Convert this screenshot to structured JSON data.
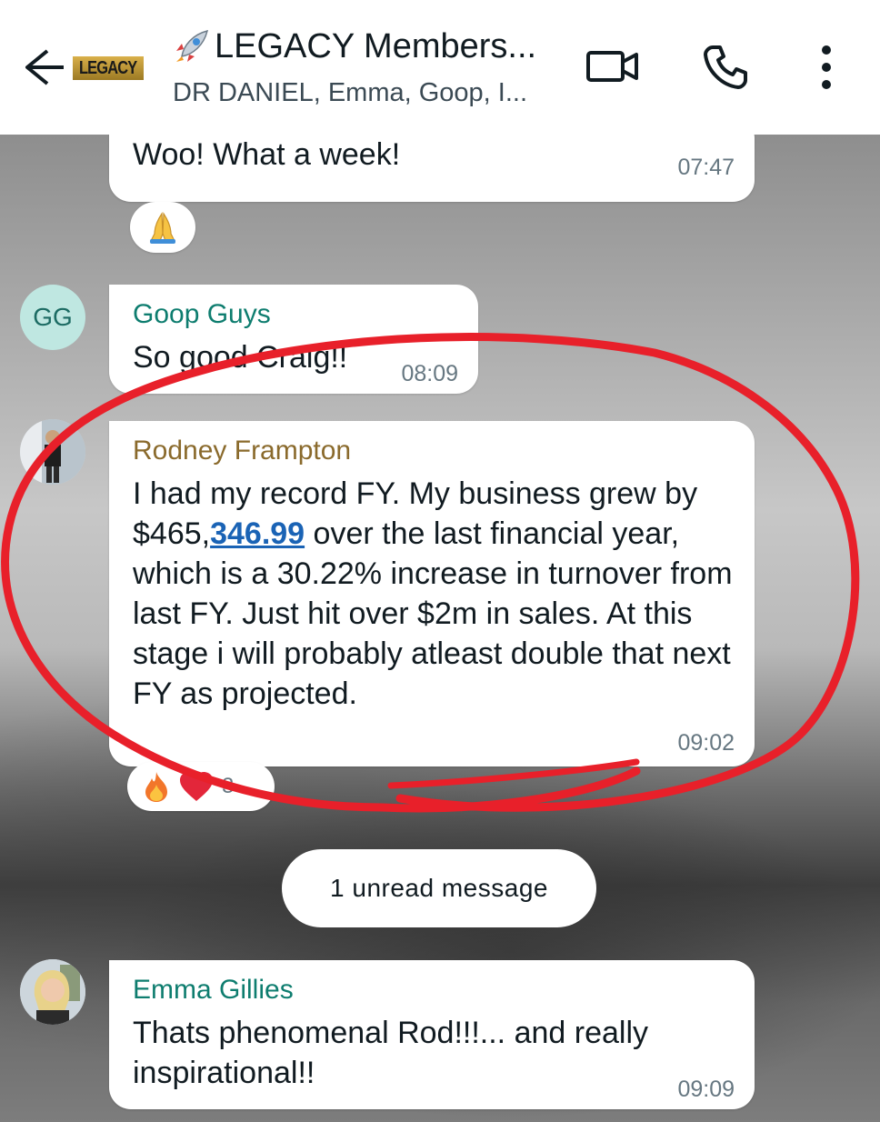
{
  "header": {
    "back_icon": "arrow-left-icon",
    "logo_text": "LEGACY",
    "title": "LEGACY Members...",
    "title_emoji": "rocket-icon",
    "subtitle": "DR DANIEL, Emma, Goop, I...",
    "actions": [
      "video-call-icon",
      "voice-call-icon",
      "more-options-icon"
    ]
  },
  "messages": [
    {
      "id": "woo",
      "text": "Woo! What a week!",
      "time": "07:47",
      "reaction": "folded-hands-icon"
    },
    {
      "id": "goop",
      "sender": "Goop Guys",
      "sender_color": "#0e7d6f",
      "avatar_initials": "GG",
      "text": "So good Craig!!",
      "time": "08:09"
    },
    {
      "id": "rod",
      "sender": "Rodney Frampton",
      "sender_color": "#8a6a2c",
      "text_part1": "I had my record FY. My business grew by $465,",
      "text_link": "346.99",
      "text_part2": " over the last financial year, which is a 30.22% increase in turnover from last FY. Just hit over $2m in sales. At this stage i will probably atleast double that next FY as projected.",
      "time": "09:02",
      "reactions": [
        "fire-icon",
        "red-heart-icon"
      ],
      "reaction_count": "3"
    },
    {
      "id": "emma",
      "sender": "Emma Gillies",
      "sender_color": "#0e7d6f",
      "text": "Thats phenomenal Rod!!!... and really inspirational!!",
      "time": "09:09"
    }
  ],
  "unread_label": "1 unread message",
  "colors": {
    "accent_teal": "#0e7d6f",
    "annotation_red": "#e8202a",
    "link_blue": "#1a63b5"
  }
}
